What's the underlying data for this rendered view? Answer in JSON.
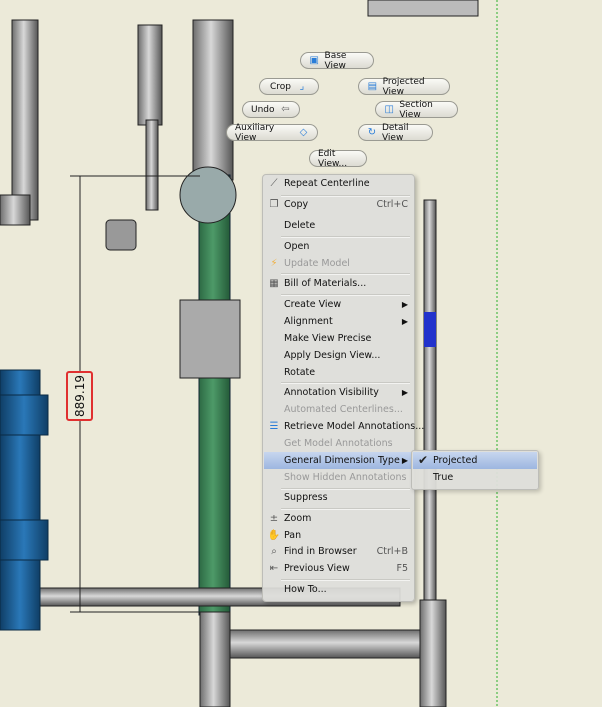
{
  "marking_menu": {
    "base_view": "Base View",
    "crop": "Crop",
    "projected_view": "Projected View",
    "undo": "Undo",
    "section_view": "Section View",
    "auxiliary_view": "Auxiliary View",
    "detail_view": "Detail View",
    "edit_view": "Edit View..."
  },
  "dimension": {
    "value": "889.19"
  },
  "context_menu": {
    "repeat_centerline": "Repeat Centerline",
    "copy": "Copy",
    "copy_shortcut": "Ctrl+C",
    "delete": "Delete",
    "open": "Open",
    "update_model": "Update Model",
    "bill_of_materials": "Bill of Materials...",
    "create_view": "Create View",
    "alignment": "Alignment",
    "make_view_precise": "Make View Precise",
    "apply_design_view": "Apply Design View...",
    "rotate": "Rotate",
    "annotation_visibility": "Annotation Visibility",
    "automated_centerlines": "Automated Centerlines...",
    "retrieve_model_annotations": "Retrieve Model Annotations...",
    "get_model_annotations": "Get Model Annotations",
    "general_dimension_type": "General Dimension Type",
    "show_hidden_annotations": "Show Hidden Annotations",
    "suppress": "Suppress",
    "zoom": "Zoom",
    "pan": "Pan",
    "find_in_browser": "Find in Browser",
    "find_shortcut": "Ctrl+B",
    "previous_view": "Previous View",
    "previous_shortcut": "F5",
    "how_to": "How To..."
  },
  "submenu": {
    "projected": "Projected",
    "true": "True",
    "selected": "Projected"
  },
  "colors": {
    "green_pipe": "#3d8a5a",
    "blue_part": "#1f5f95",
    "highlight": "#a8bfe4",
    "dimension_box": "#e03030"
  }
}
